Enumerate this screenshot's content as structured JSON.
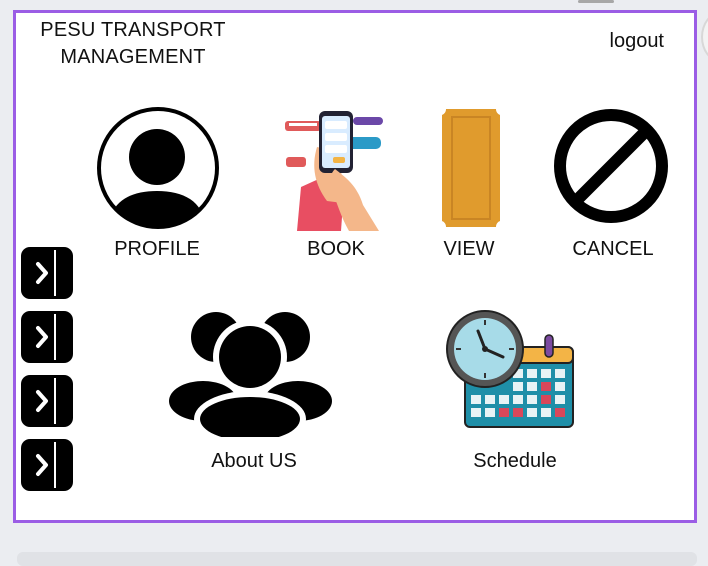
{
  "app": {
    "title_line1": "PESU TRANSPORT",
    "title_line2": "MANAGEMENT",
    "logout_label": "logout"
  },
  "tiles": {
    "profile": {
      "label": "PROFILE",
      "icon": "user-avatar-icon"
    },
    "book": {
      "label": "BOOK",
      "icon": "booking-phone-illustration-icon"
    },
    "view": {
      "label": "VIEW",
      "icon": "ticket-icon"
    },
    "cancel": {
      "label": "CANCEL",
      "icon": "prohibited-icon"
    },
    "about": {
      "label": "About US",
      "icon": "team-icon"
    },
    "schedule": {
      "label": "Schedule",
      "icon": "clock-calendar-icon"
    }
  },
  "side_nav": {
    "items": [
      {
        "icon": "chevron-right-icon"
      },
      {
        "icon": "chevron-right-icon"
      },
      {
        "icon": "chevron-right-icon"
      },
      {
        "icon": "chevron-right-icon"
      }
    ]
  },
  "colors": {
    "frame_border": "#9b5de5",
    "ticket": "#e09b2d",
    "calendar_header": "#f3b446",
    "calendar_body": "#1f8fa8",
    "clock_face": "#a7dbe8"
  }
}
